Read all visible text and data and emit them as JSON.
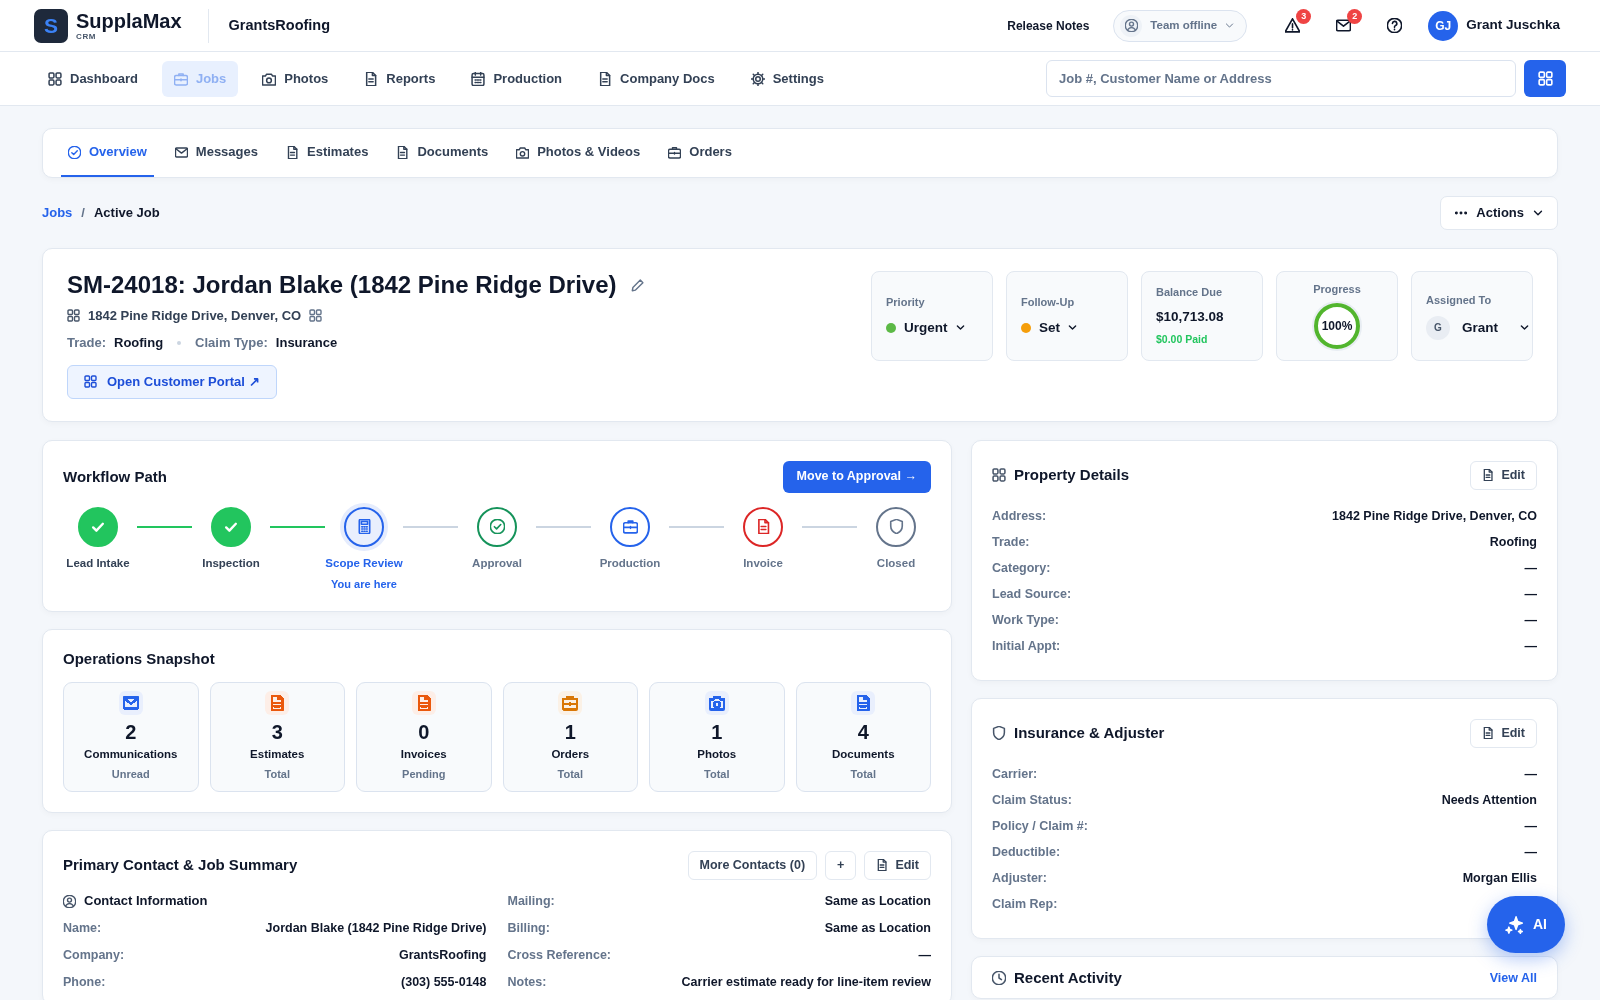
{
  "topbar": {
    "logo_letter": "S",
    "brand": "SupplaMax",
    "brand_sub": "CRM",
    "company": "GrantsRoofing",
    "release_notes": "Release Notes",
    "team_status": "Team offline",
    "alerts_count": "3",
    "messages_count": "2",
    "user": {
      "initials": "GJ",
      "name": "Grant Juschka"
    }
  },
  "nav": {
    "items": [
      {
        "label": "Dashboard",
        "kind": "dashboard",
        "selected": false
      },
      {
        "label": "Jobs",
        "kind": "jobs",
        "selected": true
      },
      {
        "label": "Photos",
        "kind": "photos",
        "selected": false
      },
      {
        "label": "Reports",
        "kind": "reports",
        "selected": false
      },
      {
        "label": "Production",
        "kind": "production",
        "selected": false
      },
      {
        "label": "Company Docs",
        "kind": "docs",
        "selected": false
      },
      {
        "label": "Settings",
        "kind": "settings",
        "selected": false
      }
    ],
    "search": {
      "placeholder": "Job #, Customer Name or Address"
    }
  },
  "tabs": [
    {
      "label": "Overview",
      "kind": "overview",
      "selected": true
    },
    {
      "label": "Messages",
      "kind": "messages",
      "selected": false
    },
    {
      "label": "Estimates",
      "kind": "estimates",
      "selected": false
    },
    {
      "label": "Documents",
      "kind": "documents",
      "selected": false
    },
    {
      "label": "Photos & Videos",
      "kind": "media",
      "selected": false
    },
    {
      "label": "Orders",
      "kind": "orders",
      "selected": false
    }
  ],
  "breadcrumb": {
    "items": [
      {
        "label": "Jobs",
        "kind": "link"
      },
      {
        "label": "Active Job",
        "kind": "current"
      }
    ],
    "separator": "/"
  },
  "actions_button": "Actions",
  "job": {
    "title": "SM-24018: Jordan Blake (1842 Pine Ridge Drive)",
    "address": "1842 Pine Ridge Drive, Denver, CO",
    "facts": [
      {
        "label": "Trade:",
        "value": "Roofing"
      },
      {
        "label": "Claim Type:",
        "value": "Insurance"
      }
    ],
    "portal_button": "Open Customer Portal ↗",
    "stats": [
      {
        "kind": "select",
        "label": "Priority",
        "value": "Urgent",
        "color": "#5cb946"
      },
      {
        "kind": "select",
        "label": "Follow-Up",
        "value": "Set",
        "color": "#f59e0b"
      },
      {
        "kind": "amount",
        "label": "Balance Due",
        "value": "$10,713.08",
        "note": "$0.00 Paid"
      },
      {
        "kind": "progress",
        "label": "Progress",
        "value": "100%",
        "level": 1
      },
      {
        "kind": "assignee",
        "label": "Assigned To",
        "initials": "G",
        "value": "Grant"
      }
    ]
  },
  "workflow": {
    "title": "Workflow Path",
    "button": "Move to Approval →",
    "steps": [
      {
        "label": "Lead Intake",
        "done": true,
        "selected": false,
        "color": "#22c55e"
      },
      {
        "label": "Inspection",
        "done": true,
        "selected": false,
        "color": "#22c55e"
      },
      {
        "label": "Scope Review",
        "kind": "scope",
        "done": false,
        "selected": true,
        "color": "#2563eb",
        "note": "You are here"
      },
      {
        "label": "Approval",
        "kind": "approval",
        "done": false,
        "selected": false,
        "color": "#15935a"
      },
      {
        "label": "Production",
        "kind": "production",
        "done": false,
        "selected": false,
        "color": "#2563eb"
      },
      {
        "label": "Invoice",
        "kind": "invoice",
        "done": false,
        "selected": false,
        "color": "#dc2626"
      },
      {
        "label": "Closed",
        "kind": "closed",
        "done": false,
        "selected": false,
        "color": "#64748b"
      }
    ]
  },
  "property": {
    "title": "Property Details",
    "edit": "Edit",
    "rows": [
      {
        "label": "Address:",
        "value": "1842 Pine Ridge Drive, Denver, CO"
      },
      {
        "label": "Trade:",
        "value": "Roofing"
      },
      {
        "label": "Category:",
        "value": "—"
      },
      {
        "label": "Lead Source:",
        "value": "—"
      },
      {
        "label": "Work Type:",
        "value": "—"
      },
      {
        "label": "Initial Appt:",
        "value": "—"
      }
    ]
  },
  "operations": {
    "title": "Operations Snapshot",
    "tiles": [
      {
        "count": "2",
        "label": "Communications",
        "sub": "Unread",
        "kind": "communications",
        "color": "#2563eb"
      },
      {
        "count": "3",
        "label": "Estimates",
        "sub": "Total",
        "kind": "estimates",
        "color": "#ea580c"
      },
      {
        "count": "0",
        "label": "Invoices",
        "sub": "Pending",
        "kind": "invoices",
        "color": "#ea580c"
      },
      {
        "count": "1",
        "label": "Orders",
        "sub": "Total",
        "kind": "orders",
        "color": "#d97706"
      },
      {
        "count": "1",
        "label": "Photos",
        "sub": "Total",
        "kind": "photos",
        "color": "#2563eb"
      },
      {
        "count": "4",
        "label": "Documents",
        "sub": "Total",
        "kind": "documents",
        "color": "#2563eb"
      }
    ]
  },
  "insurance": {
    "title": "Insurance & Adjuster",
    "edit": "Edit",
    "rows": [
      {
        "label": "Carrier:",
        "value": "—"
      },
      {
        "label": "Claim Status:",
        "value": "Needs Attention"
      },
      {
        "label": "Policy / Claim #:",
        "value": "—"
      },
      {
        "label": "Deductible:",
        "value": "—"
      },
      {
        "label": "Adjuster:",
        "value": "Morgan Ellis"
      },
      {
        "label": "Claim Rep:"
      }
    ]
  },
  "contact": {
    "title": "Primary Contact & Job Summary",
    "buttons": [
      {
        "kind": "more",
        "label": "More Contacts (0)"
      },
      {
        "kind": "add",
        "label": "+"
      },
      {
        "kind": "edit",
        "label": "Edit"
      }
    ],
    "section": "Contact Information",
    "rows": [
      {
        "label": "Name:",
        "value": "Jordan Blake (1842 Pine Ridge Drive)"
      },
      {
        "label": "Company:",
        "value": "GrantsRoofing"
      },
      {
        "label": "Phone:",
        "value": "(303) 555-0148"
      }
    ],
    "summary_rows": [
      {
        "label": "Mailing:",
        "value": "Same as Location"
      },
      {
        "label": "Billing:",
        "value": "Same as Location"
      },
      {
        "label": "Cross Reference:",
        "value": "—"
      },
      {
        "label": "Notes:",
        "value": "Carrier estimate ready for line-item review"
      }
    ]
  },
  "activity": {
    "title": "Recent Activity",
    "link": "View All"
  },
  "ai_button": "AI"
}
